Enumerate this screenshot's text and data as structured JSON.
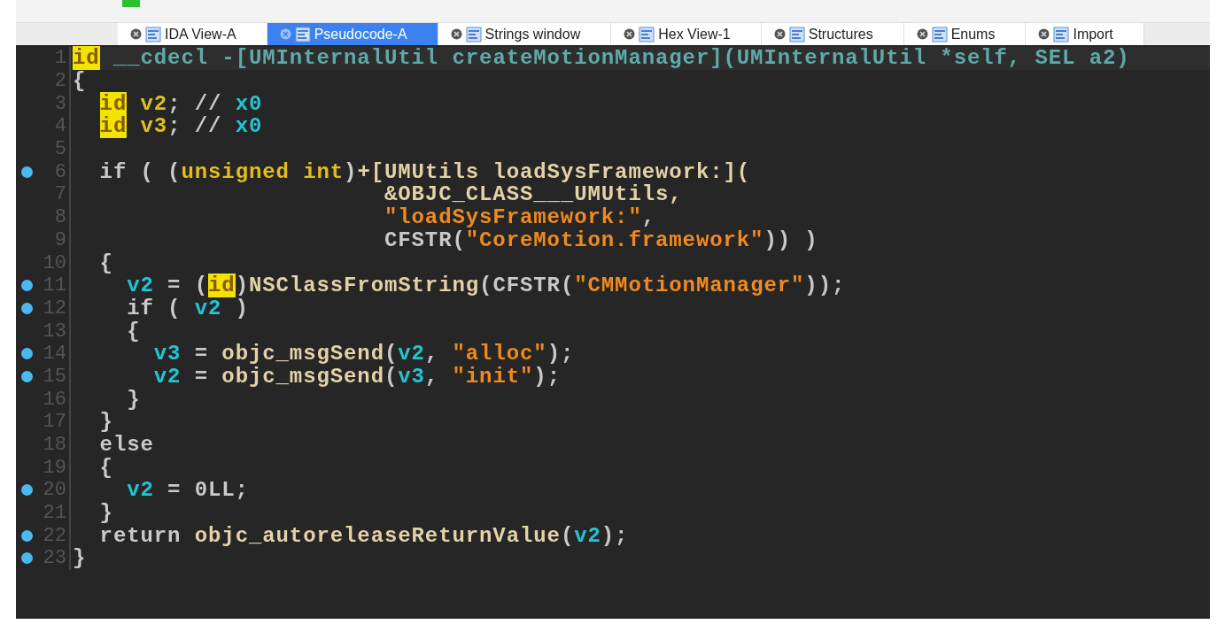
{
  "tabs": [
    {
      "label": "IDA View-A",
      "selected": false
    },
    {
      "label": "Pseudocode-A",
      "selected": true
    },
    {
      "label": "Strings window",
      "selected": false
    },
    {
      "label": "Hex View-1",
      "selected": false
    },
    {
      "label": "Structures",
      "selected": false
    },
    {
      "label": "Enums",
      "selected": false
    },
    {
      "label": "Import",
      "selected": false
    }
  ],
  "code": [
    {
      "number": "1",
      "breakpoint": false,
      "tokens": [
        {
          "kind": "hl",
          "text": "id"
        },
        {
          "kind": "header",
          "text": " __cdecl -[UMInternalUtil createMotionManager](UMInternalUtil *self, SEL a2)"
        }
      ]
    },
    {
      "number": "2",
      "breakpoint": false,
      "tokens": [
        {
          "kind": "plain",
          "text": "{"
        }
      ],
      "children": [
        {
          "number": "3",
          "breakpoint": false,
          "tokens": [
            {
              "kind": "hl",
              "text": "id"
            },
            {
              "kind": "type",
              "text": " v2"
            },
            {
              "kind": "plain",
              "text": "; // "
            },
            {
              "kind": "var",
              "text": "x0"
            }
          ]
        },
        {
          "number": "4",
          "breakpoint": false,
          "tokens": [
            {
              "kind": "hl",
              "text": "id"
            },
            {
              "kind": "type",
              "text": " v3"
            },
            {
              "kind": "plain",
              "text": "; // "
            },
            {
              "kind": "var",
              "text": "x0"
            }
          ]
        },
        {
          "number": "5",
          "breakpoint": false
        },
        {
          "number": "6",
          "breakpoint": true,
          "tokens": [
            {
              "kind": "plain",
              "text": "if ( ("
            },
            {
              "kind": "type",
              "text": "unsigned int"
            },
            {
              "kind": "plain",
              "text": ")"
            },
            {
              "kind": "func",
              "text": "+[UMUtils loadSysFramework:]("
            }
          ]
        },
        {
          "number": "7",
          "breakpoint": false,
          "tokens": [
            {
              "kind": "func",
              "text": "                     &OBJC_CLASS___UMUtils,"
            }
          ]
        },
        {
          "number": "8",
          "breakpoint": false,
          "tokens": [
            {
              "kind": "str",
              "text": "                     \"loadSysFramework:\""
            },
            {
              "kind": "plain",
              "text": ","
            }
          ]
        },
        {
          "number": "9",
          "breakpoint": false,
          "tokens": [
            {
              "kind": "plain",
              "text": "                     CFSTR("
            },
            {
              "kind": "str",
              "text": "\"CoreMotion.framework\""
            },
            {
              "kind": "plain",
              "text": ")) )"
            }
          ]
        },
        {
          "number": "10",
          "breakpoint": false,
          "tokens": [
            {
              "kind": "plain",
              "text": "{"
            }
          ],
          "children": [
            {
              "number": "11",
              "breakpoint": true,
              "tokens": [
                {
                  "kind": "var",
                  "text": "v2"
                },
                {
                  "kind": "plain",
                  "text": " = ("
                },
                {
                  "kind": "hl",
                  "text": "id"
                },
                {
                  "kind": "plain",
                  "text": ")"
                },
                {
                  "kind": "func",
                  "text": "NSClassFromString"
                },
                {
                  "kind": "plain",
                  "text": "(CFSTR("
                },
                {
                  "kind": "str",
                  "text": "\"CMMotionManager\""
                },
                {
                  "kind": "plain",
                  "text": "));"
                }
              ]
            },
            {
              "number": "12",
              "breakpoint": true,
              "tokens": [
                {
                  "kind": "plain",
                  "text": "if ( "
                },
                {
                  "kind": "var",
                  "text": "v2"
                },
                {
                  "kind": "plain",
                  "text": " )"
                }
              ]
            },
            {
              "number": "13",
              "breakpoint": false,
              "tokens": [
                {
                  "kind": "plain",
                  "text": "{"
                }
              ],
              "children": [
                {
                  "number": "14",
                  "breakpoint": true,
                  "tokens": [
                    {
                      "kind": "var",
                      "text": "v3"
                    },
                    {
                      "kind": "plain",
                      "text": " = "
                    },
                    {
                      "kind": "func",
                      "text": "objc_msgSend"
                    },
                    {
                      "kind": "plain",
                      "text": "("
                    },
                    {
                      "kind": "var",
                      "text": "v2"
                    },
                    {
                      "kind": "plain",
                      "text": ", "
                    },
                    {
                      "kind": "str",
                      "text": "\"alloc\""
                    },
                    {
                      "kind": "plain",
                      "text": ");"
                    }
                  ]
                },
                {
                  "number": "15",
                  "breakpoint": true,
                  "tokens": [
                    {
                      "kind": "var",
                      "text": "v2"
                    },
                    {
                      "kind": "plain",
                      "text": " = "
                    },
                    {
                      "kind": "func",
                      "text": "objc_msgSend"
                    },
                    {
                      "kind": "plain",
                      "text": "("
                    },
                    {
                      "kind": "var",
                      "text": "v3"
                    },
                    {
                      "kind": "plain",
                      "text": ", "
                    },
                    {
                      "kind": "str",
                      "text": "\"init\""
                    },
                    {
                      "kind": "plain",
                      "text": ");"
                    }
                  ]
                }
              ]
            },
            {
              "number": "16",
              "breakpoint": false,
              "tokens": [
                {
                  "kind": "plain",
                  "text": "}"
                }
              ]
            }
          ]
        },
        {
          "number": "17",
          "breakpoint": false,
          "tokens": [
            {
              "kind": "plain",
              "text": "}"
            }
          ]
        },
        {
          "number": "18",
          "breakpoint": false,
          "tokens": [
            {
              "kind": "plain",
              "text": "else"
            }
          ]
        },
        {
          "number": "19",
          "breakpoint": false,
          "tokens": [
            {
              "kind": "plain",
              "text": "{"
            }
          ],
          "children": [
            {
              "number": "20",
              "breakpoint": true,
              "tokens": [
                {
                  "kind": "var",
                  "text": "v2"
                },
                {
                  "kind": "plain",
                  "text": " = 0LL;"
                }
              ]
            }
          ]
        },
        {
          "number": "21",
          "breakpoint": false,
          "tokens": [
            {
              "kind": "plain",
              "text": "}"
            }
          ]
        },
        {
          "number": "22",
          "breakpoint": true,
          "tokens": [
            {
              "kind": "plain",
              "text": "return "
            },
            {
              "kind": "func",
              "text": "objc_autoreleaseReturnValue"
            },
            {
              "kind": "plain",
              "text": "("
            },
            {
              "kind": "var",
              "text": "v2"
            },
            {
              "kind": "plain",
              "text": ");"
            }
          ]
        }
      ]
    },
    {
      "number": "23",
      "breakpoint": true,
      "tokens": [
        {
          "kind": "plain",
          "text": "}"
        }
      ]
    }
  ]
}
